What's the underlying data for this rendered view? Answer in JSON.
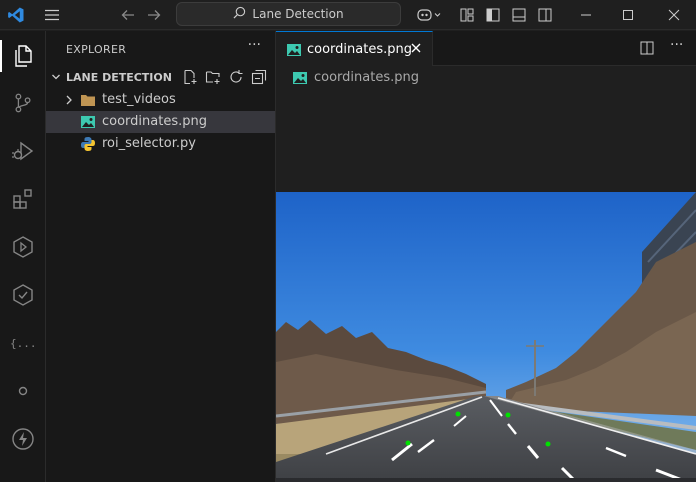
{
  "titlebar": {
    "search_text": "Lane Detection",
    "icons": [
      "vscode-logo-icon",
      "menu-icon",
      "back-arrow-icon",
      "forward-arrow-icon",
      "search-icon",
      "copilot-icon",
      "layout-icon",
      "toggle-sidebar-icon",
      "toggle-panel-icon",
      "toggle-secondary-sidebar-icon",
      "minimize-icon",
      "maximize-icon",
      "close-icon"
    ]
  },
  "activity_bar": {
    "items": [
      "explorer-icon",
      "source-control-icon",
      "run-debug-icon",
      "extensions-icon",
      "remote-explorer-icon",
      "testing-icon",
      "json-icon",
      "copilot-chat-icon",
      "thunder-icon"
    ]
  },
  "explorer": {
    "title": "EXPLORER",
    "more": "···",
    "section_label": "LANE DETECTION",
    "files": [
      {
        "name": "test_videos",
        "type": "folder"
      },
      {
        "name": "coordinates.png",
        "type": "image",
        "selected": true
      },
      {
        "name": "roi_selector.py",
        "type": "python"
      }
    ]
  },
  "editor": {
    "tab_label": "coordinates.png",
    "breadcrumb": "coordinates.png",
    "more": "···"
  },
  "colors": {
    "accent": "#0078d4",
    "image_icon": "#3dc9b0",
    "folder": "#c09553",
    "roi_point": "#00e000"
  }
}
